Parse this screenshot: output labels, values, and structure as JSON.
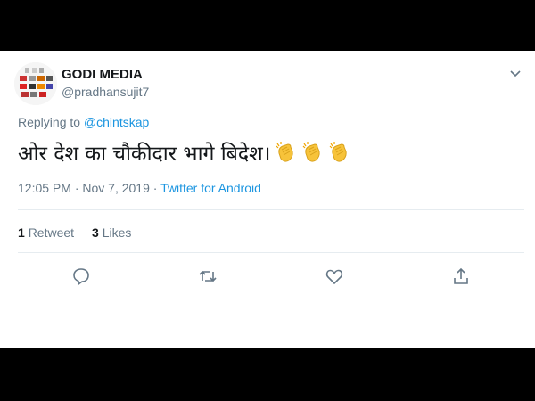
{
  "tweet": {
    "display_name": "GODI MEDIA",
    "handle": "@pradhansujit7",
    "replying_to_prefix": "Replying to",
    "replying_to_user": "@chintskap",
    "text": "ओर देश का चौकीदार भागे बिदेश।",
    "emoji": [
      "clapping-hands",
      "clapping-hands",
      "clapping-hands"
    ],
    "timestamp": "12:05 PM · Nov 7, 2019",
    "separator": "·",
    "source": "Twitter for Android"
  },
  "stats": {
    "retweet_count": "1",
    "retweet_label": "Retweet",
    "like_count": "3",
    "like_label": "Likes"
  },
  "actions": [
    "reply-icon",
    "retweet-icon",
    "like-icon",
    "share-icon"
  ],
  "colors": {
    "link": "#1b95e0",
    "secondary_text": "#657786",
    "primary_text": "#14171a",
    "divider": "#e6ecf0",
    "frame": "#000000"
  }
}
